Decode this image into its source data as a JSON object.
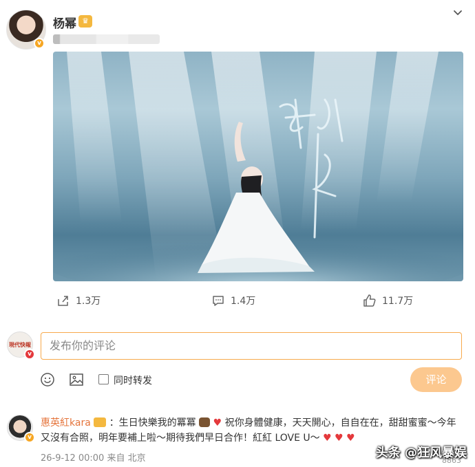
{
  "post": {
    "author": "杨幂",
    "media": {
      "caption_text": "生日快乐"
    },
    "actions": {
      "repost_count": "1.3万",
      "comment_count": "1.4万",
      "like_count": "11.7万"
    }
  },
  "composer": {
    "placeholder": "发布你的评论",
    "repost_label": "同时转发",
    "submit_label": "评论"
  },
  "reply": {
    "user": "惠英紅kara",
    "text": "：生日快樂我的冪冪 ",
    "text2": " 祝你身體健康，天天開心，自自在在，甜甜蜜蜜～今年又沒有合照，明年要補上啦～期待我們早日合作！紅紅 LOVE U～",
    "meta": "26-9-12 00:00 来自 北京",
    "likes_partial": "8863"
  },
  "watermark": "头条 @狂风暴娱",
  "colors": {
    "accent": "#f7a94b",
    "submit_bg": "#fcc88f",
    "username": "#e5743b",
    "heart": "#e4393c"
  }
}
